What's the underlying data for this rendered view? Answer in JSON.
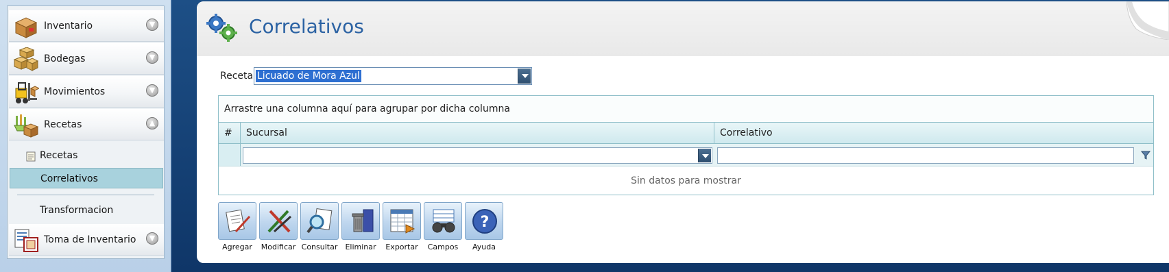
{
  "sidebar": {
    "groups": [
      {
        "label": "Inventario",
        "icon": "box-icon",
        "expanded": false
      },
      {
        "label": "Bodegas",
        "icon": "boxes-icon",
        "expanded": false
      },
      {
        "label": "Movimientos",
        "icon": "forklift-icon",
        "expanded": false
      },
      {
        "label": "Recetas",
        "icon": "recipe-icon",
        "expanded": true
      },
      {
        "label": "Toma de Inventario",
        "icon": "inventory-list-icon",
        "expanded": false
      }
    ],
    "sub_items": [
      {
        "label": "Recetas"
      },
      {
        "label": "Correlativos",
        "selected": true
      },
      {
        "label": "Transformacion"
      }
    ]
  },
  "header": {
    "title": "Correlativos",
    "icon": "gears-icon"
  },
  "form": {
    "receta_label": "Receta",
    "receta_value": "Licuado de Mora Azul"
  },
  "grid": {
    "group_panel_text": "Arrastre una columna aquí para agrupar por dicha columna",
    "columns": [
      "#",
      "Sucursal",
      "Correlativo"
    ],
    "filter": {
      "sucursal": "",
      "correlativo": ""
    },
    "empty_text": "Sin datos para mostrar"
  },
  "toolbar": {
    "buttons": [
      {
        "label": "Agregar",
        "icon": "add-document-icon"
      },
      {
        "label": "Modificar",
        "icon": "edit-pencils-icon"
      },
      {
        "label": "Consultar",
        "icon": "magnifier-document-icon"
      },
      {
        "label": "Eliminar",
        "icon": "trash-icon"
      },
      {
        "label": "Exportar",
        "icon": "spreadsheet-export-icon"
      },
      {
        "label": "Campos",
        "icon": "binoculars-icon"
      },
      {
        "label": "Ayuda",
        "icon": "help-icon"
      }
    ]
  },
  "colors": {
    "title": "#2b62a3",
    "selected_item_bg": "#a8d2dd",
    "selection_highlight": "#2e6fd1",
    "background_blue": "#1d4f86"
  }
}
